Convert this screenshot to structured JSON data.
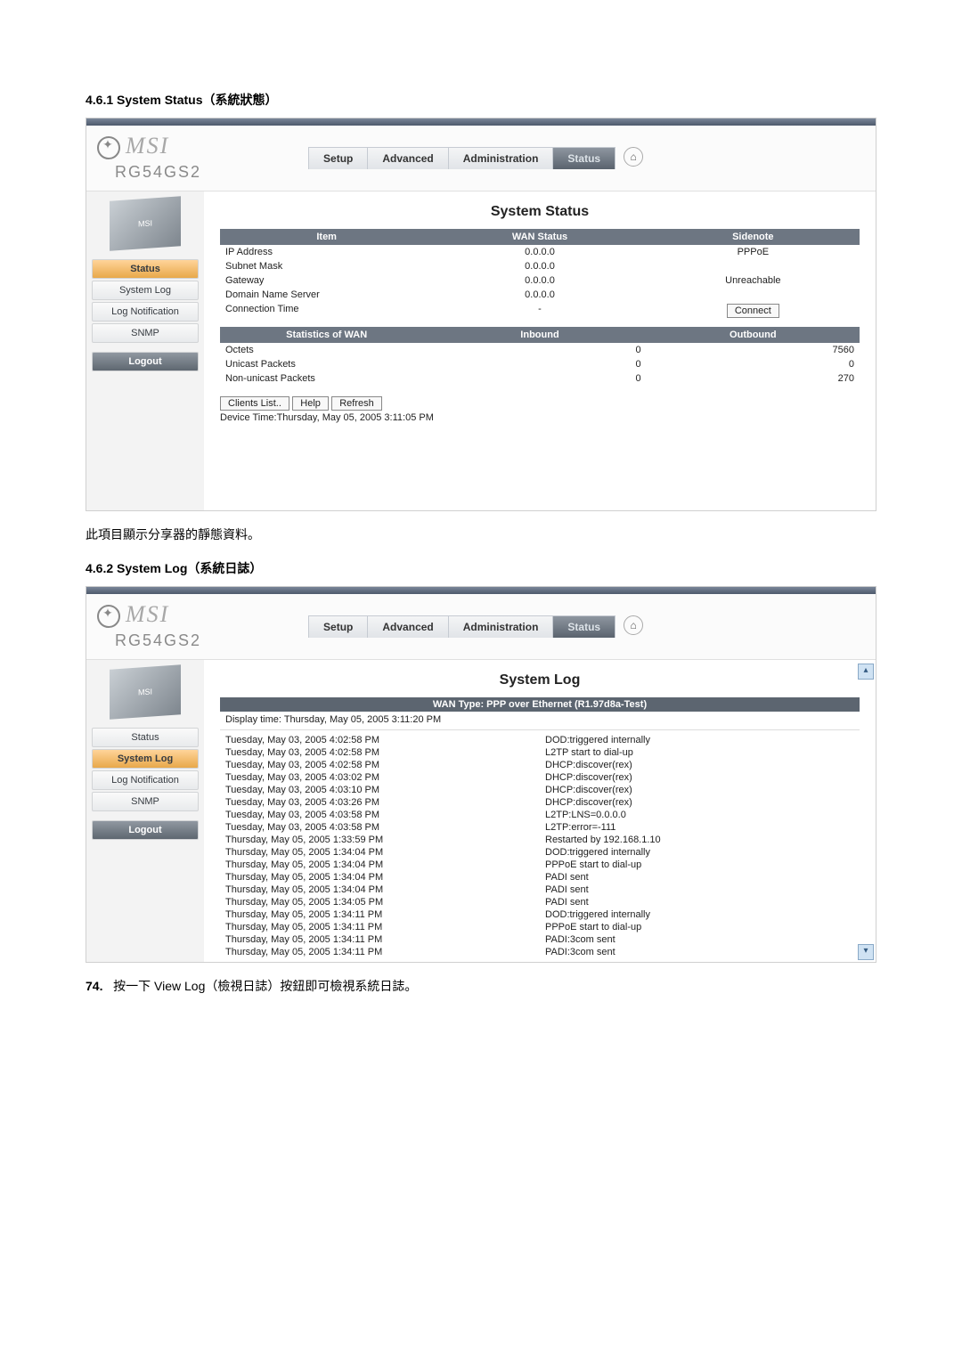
{
  "doc": {
    "sec1_no": "4.6.1 System Status",
    "sec1_cn": "（系統狀態）",
    "sec2_no": "4.6.2 System Log",
    "sec2_cn": "（系統日誌）",
    "caption1": "此項目顯示分享器的靜態資料。",
    "footer_no": "74.",
    "footer_text": "按一下 View Log（檢視日誌）按鈕即可檢視系統日誌。"
  },
  "brand": {
    "logo_text": "MSI",
    "model": "RG54GS2",
    "product_tag": "MSI"
  },
  "tabs": {
    "setup": "Setup",
    "advanced": "Advanced",
    "admin": "Administration",
    "status": "Status"
  },
  "sidebar": {
    "status": "Status",
    "system_log": "System Log",
    "log_notif": "Log Notification",
    "snmp": "SNMP",
    "logout": "Logout"
  },
  "status_page": {
    "title": "System Status",
    "head_item": "Item",
    "head_wan": "WAN Status",
    "head_side": "Sidenote",
    "rows": {
      "ip": {
        "item": "IP Address",
        "wan": "0.0.0.0",
        "side": "PPPoE"
      },
      "mask": {
        "item": "Subnet Mask",
        "wan": "0.0.0.0",
        "side": ""
      },
      "gw": {
        "item": "Gateway",
        "wan": "0.0.0.0",
        "side": "Unreachable"
      },
      "dns": {
        "item": "Domain Name Server",
        "wan": "0.0.0.0",
        "side": ""
      },
      "ct": {
        "item": "Connection Time",
        "wan": "-",
        "side_btn": "Connect"
      }
    },
    "head_stat": "Statistics of WAN",
    "head_in": "Inbound",
    "head_out": "Outbound",
    "stats": {
      "octets": {
        "item": "Octets",
        "in": "0",
        "out": "7560"
      },
      "uni": {
        "item": "Unicast Packets",
        "in": "0",
        "out": "0"
      },
      "nonuni": {
        "item": "Non-unicast Packets",
        "in": "0",
        "out": "270"
      }
    },
    "btn_clients": "Clients List..",
    "btn_help": "Help",
    "btn_refresh": "Refresh",
    "device_time": "Device Time:Thursday, May 05, 2005 3:11:05 PM"
  },
  "log_page": {
    "title": "System Log",
    "wan_type": "WAN Type: PPP over Ethernet (R1.97d8a-Test)",
    "display_time": "Display time: Thursday, May 05, 2005 3:11:20 PM",
    "entries": [
      {
        "t": "Tuesday, May 03, 2005 4:02:58 PM",
        "m": "DOD:triggered internally"
      },
      {
        "t": "Tuesday, May 03, 2005 4:02:58 PM",
        "m": "L2TP start to dial-up"
      },
      {
        "t": "Tuesday, May 03, 2005 4:02:58 PM",
        "m": "DHCP:discover(rex)"
      },
      {
        "t": "Tuesday, May 03, 2005 4:03:02 PM",
        "m": "DHCP:discover(rex)"
      },
      {
        "t": "Tuesday, May 03, 2005 4:03:10 PM",
        "m": "DHCP:discover(rex)"
      },
      {
        "t": "Tuesday, May 03, 2005 4:03:26 PM",
        "m": "DHCP:discover(rex)"
      },
      {
        "t": "Tuesday, May 03, 2005 4:03:58 PM",
        "m": "L2TP:LNS=0.0.0.0"
      },
      {
        "t": "Tuesday, May 03, 2005 4:03:58 PM",
        "m": "L2TP:error=-111"
      },
      {
        "t": "Thursday, May 05, 2005 1:33:59 PM",
        "m": "Restarted by 192.168.1.10"
      },
      {
        "t": "Thursday, May 05, 2005 1:34:04 PM",
        "m": "DOD:triggered internally"
      },
      {
        "t": "Thursday, May 05, 2005 1:34:04 PM",
        "m": "PPPoE start to dial-up"
      },
      {
        "t": "Thursday, May 05, 2005 1:34:04 PM",
        "m": "PADI sent"
      },
      {
        "t": "Thursday, May 05, 2005 1:34:04 PM",
        "m": "PADI sent"
      },
      {
        "t": "Thursday, May 05, 2005 1:34:05 PM",
        "m": "PADI sent"
      },
      {
        "t": "Thursday, May 05, 2005 1:34:11 PM",
        "m": "DOD:triggered internally"
      },
      {
        "t": "Thursday, May 05, 2005 1:34:11 PM",
        "m": "PPPoE start to dial-up"
      },
      {
        "t": "Thursday, May 05, 2005 1:34:11 PM",
        "m": "PADI:3com sent"
      },
      {
        "t": "Thursday, May 05, 2005 1:34:11 PM",
        "m": "PADI:3com sent"
      }
    ]
  }
}
